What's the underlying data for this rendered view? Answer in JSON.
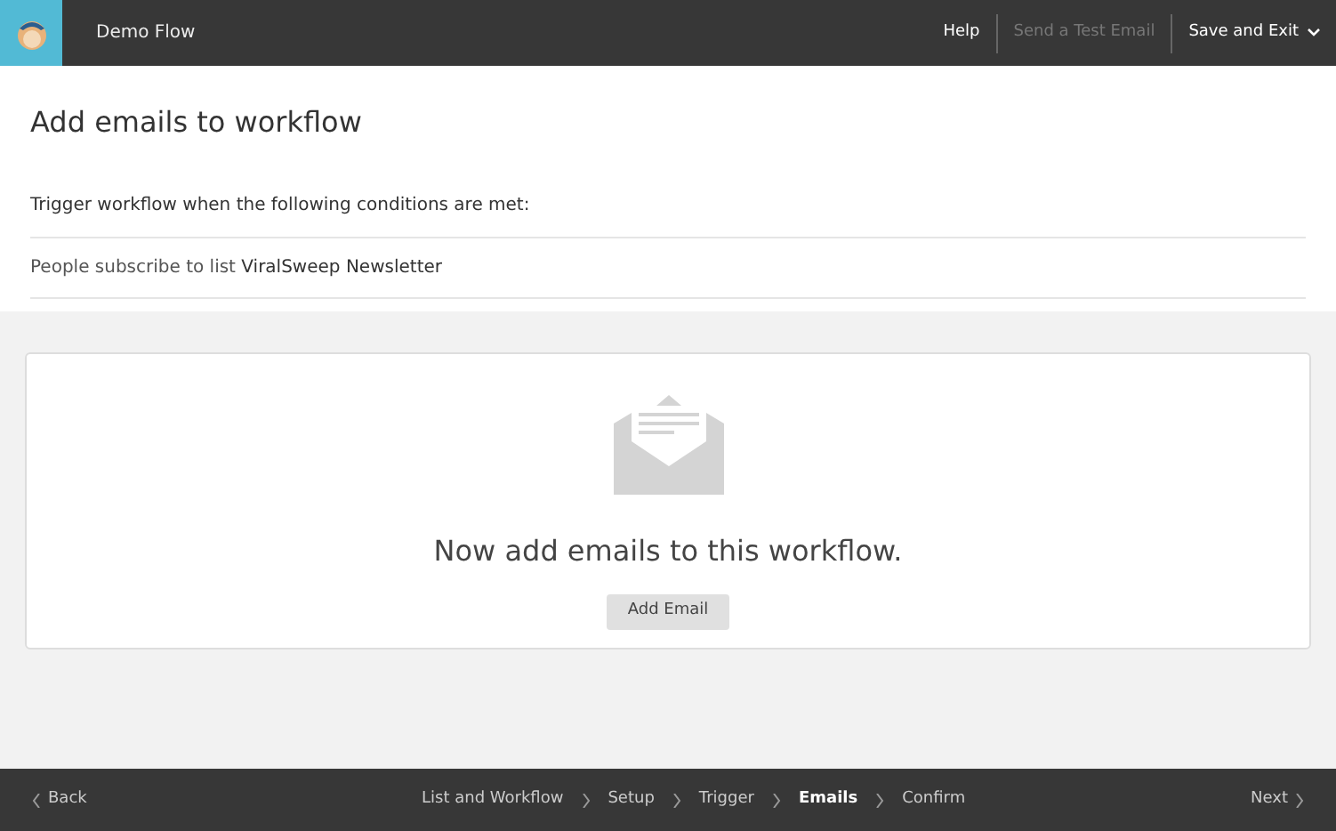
{
  "header": {
    "title": "Demo Flow",
    "actions": [
      {
        "label": "Help",
        "disabled": false,
        "kind": "link"
      },
      {
        "label": "Send a Test Email",
        "disabled": true,
        "kind": "link"
      },
      {
        "label": "Save and Exit",
        "disabled": false,
        "kind": "menu"
      }
    ]
  },
  "page": {
    "heading": "Add emails to workflow",
    "trigger_heading": "Trigger workflow when the following conditions are met:",
    "condition": "People subscribe to list **ViralSweep Newsletter**"
  },
  "empty_state": {
    "message": "Now add emails to this workflow.",
    "button": "Add Email"
  },
  "footer": {
    "back": "Back",
    "next": "Next",
    "steps": [
      {
        "label": "List and Workflow",
        "selected": false
      },
      {
        "label": "Setup",
        "selected": false
      },
      {
        "label": "Trigger",
        "selected": false
      },
      {
        "label": "Emails",
        "selected": true
      },
      {
        "label": "Confirm",
        "selected": false
      }
    ]
  }
}
